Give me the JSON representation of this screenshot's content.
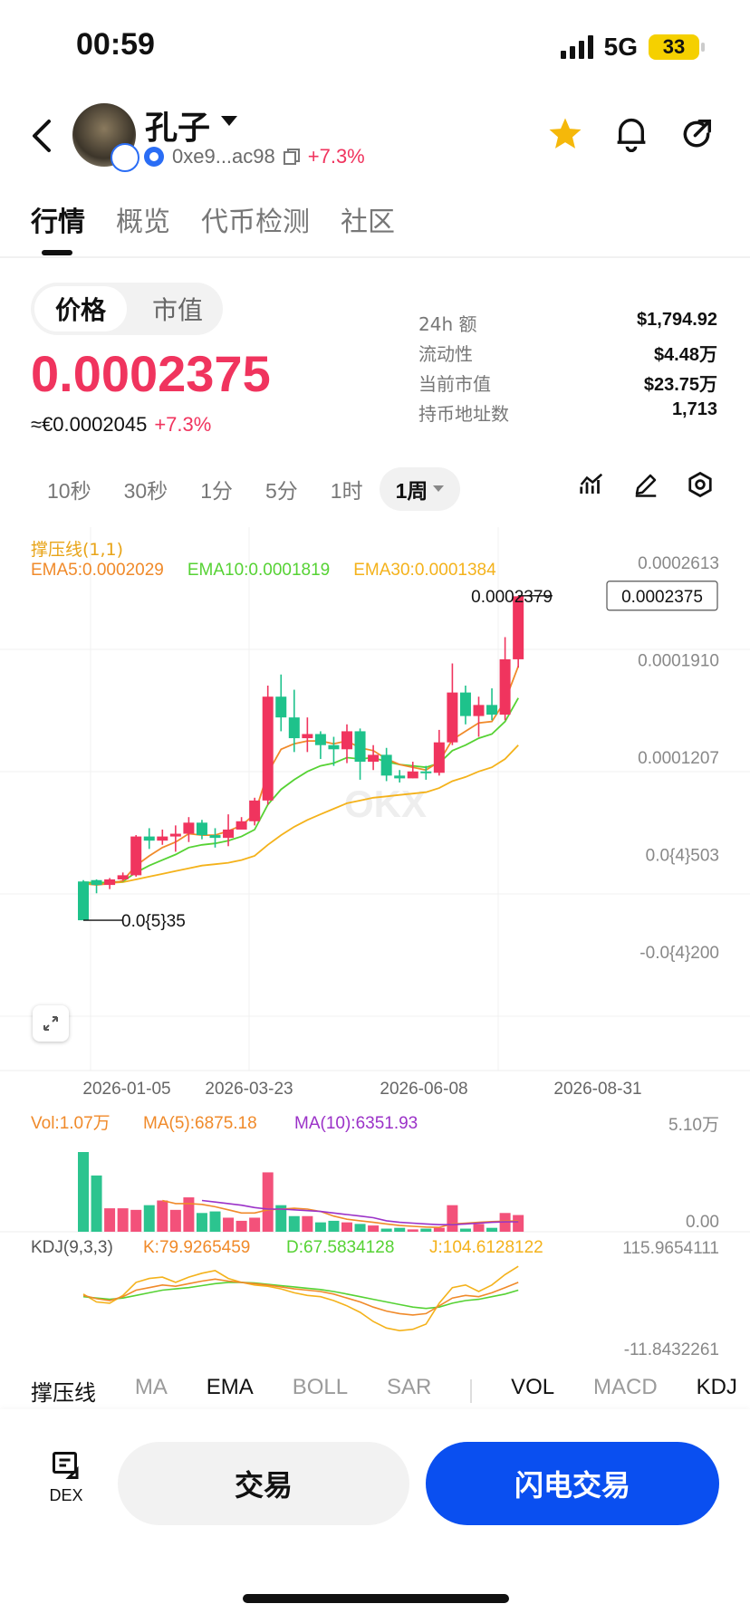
{
  "status": {
    "time": "00:59",
    "network": "5G",
    "battery": "33"
  },
  "header": {
    "token_name": "孔子",
    "address": "0xe9...ac98",
    "change": "+7.3%",
    "icons": [
      "back-icon",
      "star-icon",
      "bell-icon",
      "share-icon"
    ]
  },
  "tabs": [
    "行情",
    "概览",
    "代币检测",
    "社区"
  ],
  "price_toggle": {
    "a": "价格",
    "b": "市值"
  },
  "price": {
    "main": "0.0002375",
    "eur": "≈€0.0002045",
    "eur_change": "+7.3%"
  },
  "stats": [
    {
      "k": "24h  额",
      "v": "$1,794.92"
    },
    {
      "k": "流动性",
      "v": "$4.48万"
    },
    {
      "k": "当前市值",
      "v": "$23.75万"
    },
    {
      "k": "持币地址数",
      "v": "1,713"
    }
  ],
  "intervals": [
    "10秒",
    "30秒",
    "1分",
    "5分",
    "1时",
    "1周"
  ],
  "interval_selected": "1周",
  "chart": {
    "legend_title": "撑压线(1,1)",
    "ema5": "EMA5:0.0002029",
    "ema10": "EMA10:0.0001819",
    "ema30": "EMA30:0.0001384",
    "price_ticks": [
      "0.0002613",
      "0.0001910",
      "0.0001207",
      "0.0{4}503",
      "-0.0{4}200"
    ],
    "high_label": "0.0002379",
    "low_label": "0.0{5}35",
    "current_label": "0.0002375",
    "date_ticks": [
      "2026-01-05",
      "2026-03-23",
      "2026-06-08",
      "2026-08-31"
    ],
    "vol": "Vol:1.07万",
    "vol_ma5": "MA(5):6875.18",
    "vol_ma10": "MA(10):6351.93",
    "vol_ticks": [
      "5.10万",
      "0.00"
    ],
    "kdj": "KDJ(9,3,3)",
    "k": "K:79.9265459",
    "d": "D:67.5834128",
    "j": "J:104.6128122",
    "kdj_ticks": [
      "115.9654111",
      "-11.8432261"
    ]
  },
  "chart_data": {
    "type": "candlestick",
    "colors": {
      "up": "#f0345e",
      "down": "#1ec28b",
      "ema5": "#f08a2a",
      "ema10": "#56d234",
      "ema30": "#f4b21b",
      "ma10": "#9b32c8"
    },
    "candles": [
      [
        3.15e-05,
        3.5e-06,
        3.25e-05,
        3.5e-06
      ],
      [
        3.25e-05,
        2.9e-05,
        3.3e-05,
        2.3e-05
      ],
      [
        2.9e-05,
        3.3e-05,
        3.4e-05,
        2.6e-05
      ],
      [
        3.3e-05,
        3.6e-05,
        3.8e-05,
        3.2e-05
      ],
      [
        3.6e-05,
        6.4e-05,
        6.5e-05,
        3.5e-05
      ],
      [
        6.4e-05,
        6.1e-05,
        7e-05,
        5.5e-05
      ],
      [
        6.1e-05,
        6.4e-05,
        6.9e-05,
        5.8e-05
      ],
      [
        6.4e-05,
        6.6e-05,
        7.2e-05,
        5.3e-05
      ],
      [
        6.6e-05,
        7.4e-05,
        7.8e-05,
        6e-05
      ],
      [
        7.4e-05,
        6.5e-05,
        7.6e-05,
        6.2e-05
      ],
      [
        6.5e-05,
        6.3e-05,
        7e-05,
        5.6e-05
      ],
      [
        6.3e-05,
        6.9e-05,
        8e-05,
        5.7e-05
      ],
      [
        6.9e-05,
        7.5e-05,
        7.8e-05,
        7e-05
      ],
      [
        7.5e-05,
        9e-05,
        9.2e-05,
        7.2e-05
      ],
      [
        9e-05,
        0.000165,
        0.000173,
        8.7e-05
      ],
      [
        0.000165,
        0.00015,
        0.000181,
        0.00014
      ],
      [
        0.00015,
        0.000135,
        0.00017,
        0.000125
      ],
      [
        0.000135,
        0.000138,
        0.00015,
        0.000125
      ],
      [
        0.000138,
        0.00013,
        0.00014,
        0.00012
      ],
      [
        0.00013,
        0.000127,
        0.000136,
        0.000115
      ],
      [
        0.000127,
        0.00014,
        0.000145,
        0.000117
      ],
      [
        0.00014,
        0.000118,
        0.000142,
        0.000105
      ],
      [
        0.000118,
        0.000123,
        0.00013,
        0.000112
      ],
      [
        0.000123,
        0.000108,
        0.000128,
        0.000104
      ],
      [
        0.000108,
        0.000106,
        0.000112,
        0.000103
      ],
      [
        0.000106,
        0.000111,
        0.000118,
        0.000106
      ],
      [
        0.000111,
        0.00011,
        0.000115,
        0.000105
      ],
      [
        0.00011,
        0.000132,
        0.000141,
        0.000108
      ],
      [
        0.000132,
        0.000168,
        0.000189,
        0.00013
      ],
      [
        0.000168,
        0.000151,
        0.000173,
        0.000145
      ],
      [
        0.000151,
        0.000159,
        0.000165,
        0.000136
      ],
      [
        0.000159,
        0.000152,
        0.000171,
        0.000148
      ],
      [
        0.000152,
        0.000192,
        0.000208,
        0.000148
      ],
      [
        0.000192,
        0.0002375,
        0.0002379,
        0.000186
      ]
    ],
    "ema5": [
      3e-05,
      2.9e-05,
      3e-05,
      3.2e-05,
      4.3e-05,
      5e-05,
      5.6e-05,
      6e-05,
      6.6e-05,
      6.5e-05,
      6.5e-05,
      6.8e-05,
      7.2e-05,
      8e-05,
      0.00011,
      0.000127,
      0.000131,
      0.000133,
      0.000133,
      0.000131,
      0.000133,
      0.000128,
      0.000126,
      0.00012,
      0.000116,
      0.000114,
      0.000112,
      0.000118,
      0.000134,
      0.00014,
      0.000146,
      0.000147,
      0.000162,
      0.000187
    ],
    "ema10": [
      3.1e-05,
      3.05e-05,
      3.1e-05,
      3.15e-05,
      3.8e-05,
      4.3e-05,
      4.7e-05,
      5.1e-05,
      5.6e-05,
      5.8e-05,
      5.9e-05,
      6.1e-05,
      6.4e-05,
      6.9e-05,
      8.7e-05,
      9.8e-05,
      0.000105,
      0.000111,
      0.000115,
      0.000117,
      0.000121,
      0.00012,
      0.000121,
      0.000118,
      0.000116,
      0.000115,
      0.000114,
      0.000117,
      0.000126,
      0.00013,
      0.000135,
      0.000138,
      0.000147,
      0.000164
    ],
    "ema30": [
      3e-05,
      3e-05,
      3.05e-05,
      3.1e-05,
      3.3e-05,
      3.5e-05,
      3.7e-05,
      3.9e-05,
      4.1e-05,
      4.3e-05,
      4.4e-05,
      4.5e-05,
      4.7e-05,
      5e-05,
      5.8e-05,
      6.5e-05,
      7.1e-05,
      7.6e-05,
      8e-05,
      8.4e-05,
      8.8e-05,
      9e-05,
      9.2e-05,
      9.3e-05,
      9.4e-05,
      9.5e-05,
      9.6e-05,
      9.9e-05,
      0.000104,
      0.000107,
      0.000111,
      0.000114,
      0.00012,
      0.00013
    ],
    "volume": [
      51000,
      36000,
      15000,
      15000,
      14000,
      17000,
      20000,
      14000,
      22000,
      12000,
      13000,
      9000,
      7000,
      9000,
      38000,
      17000,
      10000,
      10000,
      6000,
      7000,
      6000,
      5000,
      4000,
      2000,
      2500,
      1500,
      2000,
      2500,
      17000,
      2000,
      5000,
      2500,
      12000,
      10700
    ],
    "vol_ma5": [
      null,
      null,
      null,
      null,
      null,
      null,
      20000,
      18000,
      18000,
      17500,
      16000,
      14000,
      12000,
      12000,
      14000,
      14500,
      15000,
      14500,
      13000,
      10000,
      8000,
      7000,
      6000,
      5000,
      4000,
      3500,
      3000,
      2800,
      5000,
      5500,
      6000,
      6500,
      6800,
      6875
    ],
    "vol_ma10": [
      null,
      null,
      null,
      null,
      null,
      null,
      null,
      null,
      null,
      20000,
      19000,
      18000,
      17000,
      15500,
      14500,
      14500,
      14000,
      13500,
      13000,
      12000,
      11000,
      10000,
      9000,
      7000,
      6000,
      5500,
      5000,
      4500,
      4500,
      5000,
      5500,
      6000,
      6300,
      6352
    ],
    "kdj_k": [
      60,
      55,
      52,
      58,
      68,
      72,
      76,
      74,
      78,
      82,
      85,
      82,
      80,
      78,
      76,
      73,
      70,
      68,
      66,
      62,
      56,
      50,
      42,
      36,
      32,
      30,
      32,
      44,
      56,
      60,
      58,
      64,
      72,
      80
    ],
    "kdj_d": [
      58,
      56,
      54,
      56,
      60,
      64,
      68,
      70,
      72,
      75,
      78,
      80,
      80,
      79,
      77,
      75,
      73,
      71,
      69,
      66,
      62,
      58,
      54,
      50,
      46,
      42,
      40,
      42,
      48,
      52,
      54,
      58,
      62,
      68
    ],
    "kdj_j": [
      62,
      50,
      48,
      60,
      80,
      86,
      88,
      80,
      88,
      94,
      98,
      86,
      80,
      76,
      74,
      70,
      64,
      60,
      58,
      52,
      44,
      34,
      20,
      10,
      6,
      8,
      16,
      48,
      72,
      76,
      66,
      76,
      92,
      104.6
    ],
    "ylim": [
      -2e-05,
      0.0002613
    ]
  },
  "indicators": [
    "撑压线",
    "MA",
    "EMA",
    "BOLL",
    "SAR",
    "VOL",
    "MACD",
    "KDJ"
  ],
  "indicators_active": [
    "撑压线",
    "EMA",
    "VOL",
    "KDJ"
  ],
  "bottom": {
    "dex": "DEX",
    "trade": "交易",
    "flash": "闪电交易"
  }
}
